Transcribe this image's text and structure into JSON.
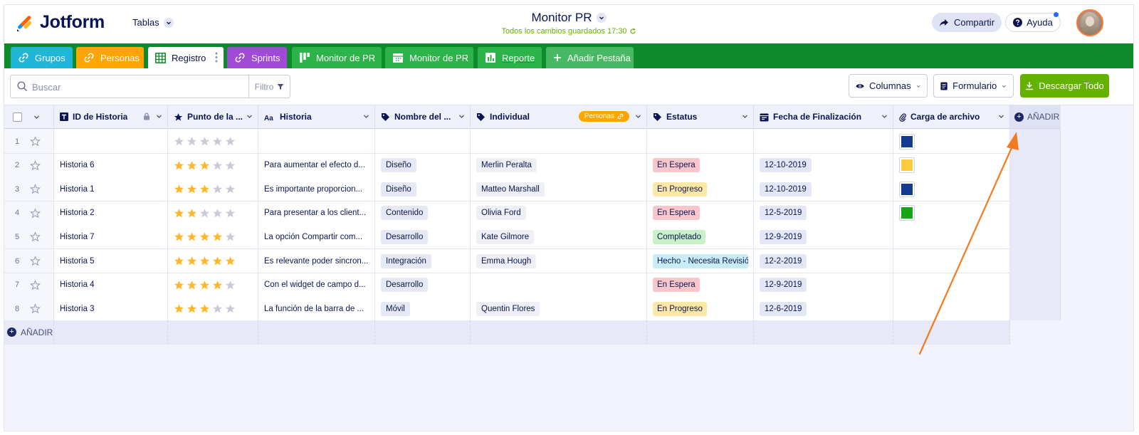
{
  "app": {
    "logo": "Jotform",
    "tables_menu": "Tablas"
  },
  "title": {
    "name": "Monitor PR",
    "saved": "Todos los cambios guardados 17:30"
  },
  "header_buttons": {
    "share": "Compartir",
    "help": "Ayuda"
  },
  "tabs": [
    {
      "label": "Grupos",
      "icon": "link-icon",
      "color": "#1fb6d9"
    },
    {
      "label": "Personas",
      "icon": "link-icon",
      "color": "#ffa400"
    },
    {
      "label": "Registro",
      "icon": "table-icon",
      "color": "#ffffff"
    },
    {
      "label": "Sprints",
      "icon": "link-icon",
      "color": "#a149d8"
    },
    {
      "label": "Monitor de PR",
      "icon": "board-icon",
      "color": "#2cb34a"
    },
    {
      "label": "Monitor de PR",
      "icon": "calendar-icon",
      "color": "#2cb34a"
    },
    {
      "label": "Reporte",
      "icon": "report-icon",
      "color": "#2cb34a"
    },
    {
      "label": "Añadir Pestaña",
      "icon": "plus-icon",
      "color": "#47b965"
    }
  ],
  "toolbar": {
    "search_placeholder": "Buscar",
    "filter": "Filtro",
    "columns": "Columnas",
    "form": "Formulario",
    "download": "Descargar Todo"
  },
  "columns": [
    {
      "label": "ID de Historia",
      "icon": "text-icon"
    },
    {
      "label": "Punto de la ...",
      "icon": "star-icon"
    },
    {
      "label": "Historia",
      "icon": "aa-icon"
    },
    {
      "label": "Nombre del ...",
      "icon": "tag-icon"
    },
    {
      "label": "Individual",
      "icon": "tag-icon",
      "badge": "Personas"
    },
    {
      "label": "Estatus",
      "icon": "tag-icon"
    },
    {
      "label": "Fecha de Finalización",
      "icon": "date-icon"
    },
    {
      "label": "Carga de archivo",
      "icon": "paperclip-icon"
    }
  ],
  "add_label": "AÑADIR",
  "status_colors": {
    "En Espera": "#f9c6cb",
    "En Progreso": "#ffe8a6",
    "Completado": "#c8f0c9",
    "Hecho - Necesita Revisión": "#c9ecf9"
  },
  "rows": [
    {
      "num": "1",
      "id": "",
      "rating": 0,
      "story": "",
      "name": "",
      "individual": "",
      "status": "",
      "date": "",
      "file": "#143a8f"
    },
    {
      "num": "2",
      "id": "Historia 6",
      "rating": 3,
      "story": "Para aumentar el efecto d...",
      "name": "Diseño",
      "individual": "Merlin Peralta",
      "status": "En Espera",
      "date": "12-10-2019",
      "file": "#ffc93c"
    },
    {
      "num": "3",
      "id": "Historia 1",
      "rating": 3,
      "story": "Es importante proporcion...",
      "name": "Diseño",
      "individual": "Matteo Marshall",
      "status": "En Progreso",
      "date": "12-10-2019",
      "file": "#143a8f"
    },
    {
      "num": "4",
      "id": "Historia 2",
      "rating": 2,
      "story": "Para presentar a los client...",
      "name": "Contenido",
      "individual": "Olivia Ford",
      "status": "En Espera",
      "date": "12-5-2019",
      "file": "#16a516"
    },
    {
      "num": "5",
      "id": "Historia 7",
      "rating": 4,
      "story": "La opción Compartir com...",
      "name": "Desarrollo",
      "individual": "Kate Gilmore",
      "status": "Completado",
      "date": "12-9-2019",
      "file": ""
    },
    {
      "num": "6",
      "id": "Historia 5",
      "rating": 5,
      "story": "Es relevante poder sincron...",
      "name": "Integración",
      "individual": "Emma Hough",
      "status": "Hecho - Necesita Revisión",
      "date": "12-2-2019",
      "file": ""
    },
    {
      "num": "7",
      "id": "Historia 4",
      "rating": 4,
      "story": "Con el widget de campo d...",
      "name": "Desarrollo",
      "individual": "",
      "status": "En Espera",
      "date": "12-9-2019",
      "file": ""
    },
    {
      "num": "8",
      "id": "Historia 3",
      "rating": 3,
      "story": "La función de la barra de ...",
      "name": "Móvil",
      "individual": "Quentin Flores",
      "status": "En Progreso",
      "date": "12-6-2019",
      "file": ""
    }
  ],
  "colors": {
    "accent_green": "#0f8a2a",
    "download_green": "#64b200",
    "navy": "#0a1551",
    "arrow_orange": "#f47a1f"
  }
}
